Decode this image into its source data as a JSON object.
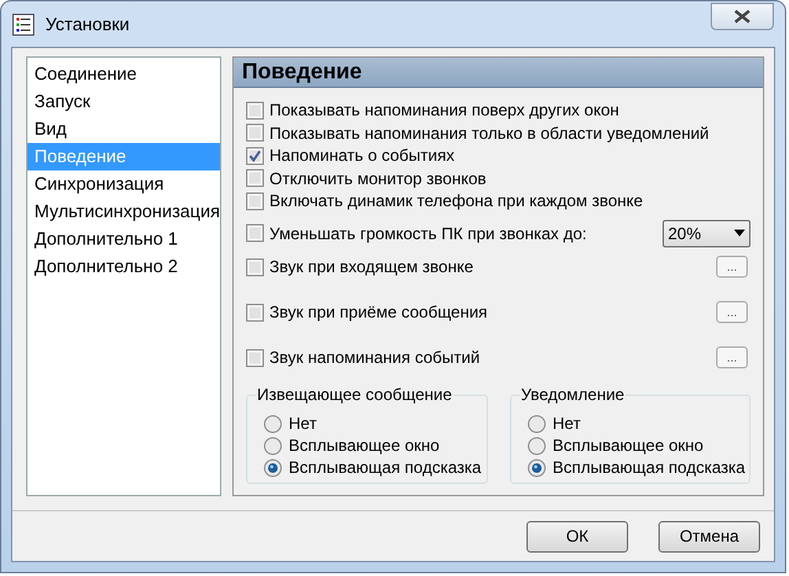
{
  "window": {
    "title": "Установки"
  },
  "sidebar": {
    "items": [
      {
        "label": "Соединение",
        "selected": false
      },
      {
        "label": "Запуск",
        "selected": false
      },
      {
        "label": "Вид",
        "selected": false
      },
      {
        "label": "Поведение",
        "selected": true
      },
      {
        "label": "Синхронизация",
        "selected": false
      },
      {
        "label": "Мультисинхронизация",
        "selected": false
      },
      {
        "label": "Дополнительно 1",
        "selected": false
      },
      {
        "label": "Дополнительно 2",
        "selected": false
      }
    ]
  },
  "panel": {
    "title": "Поведение",
    "options": [
      {
        "kind": "checkbox",
        "label": "Показывать напоминания поверх других окон",
        "checked": false
      },
      {
        "kind": "checkbox",
        "label": "Показывать напоминания только в области уведомлений",
        "checked": false
      },
      {
        "kind": "checkbox",
        "label": "Напоминать о событиях",
        "checked": true
      },
      {
        "kind": "checkbox",
        "label": "Отключить монитор звонков",
        "checked": false
      },
      {
        "kind": "checkbox",
        "label": "Включать динамик телефона при каждом звонке",
        "checked": false
      },
      {
        "kind": "dropdown",
        "label": "Уменьшать громкость ПК при звонках до:",
        "checked": false,
        "value": "20%"
      },
      {
        "kind": "browse",
        "label": "Звук при входящем звонке",
        "checked": false,
        "button": "..."
      },
      {
        "kind": "browse",
        "label": "Звук при приёме сообщения",
        "checked": false,
        "button": "..."
      },
      {
        "kind": "browse",
        "label": "Звук напоминания событий",
        "checked": false,
        "button": "..."
      }
    ],
    "groups": [
      {
        "title": "Извещающее сообщение",
        "choices": [
          {
            "label": "Нет",
            "selected": false
          },
          {
            "label": "Всплывающее окно",
            "selected": false
          },
          {
            "label": "Всплывающая подсказка",
            "selected": true
          }
        ]
      },
      {
        "title": "Уведомление",
        "choices": [
          {
            "label": "Нет",
            "selected": false
          },
          {
            "label": "Всплывающее окно",
            "selected": false
          },
          {
            "label": "Всплывающая подсказка",
            "selected": true
          }
        ]
      }
    ]
  },
  "buttons": [
    "ОК",
    "Отмена"
  ]
}
